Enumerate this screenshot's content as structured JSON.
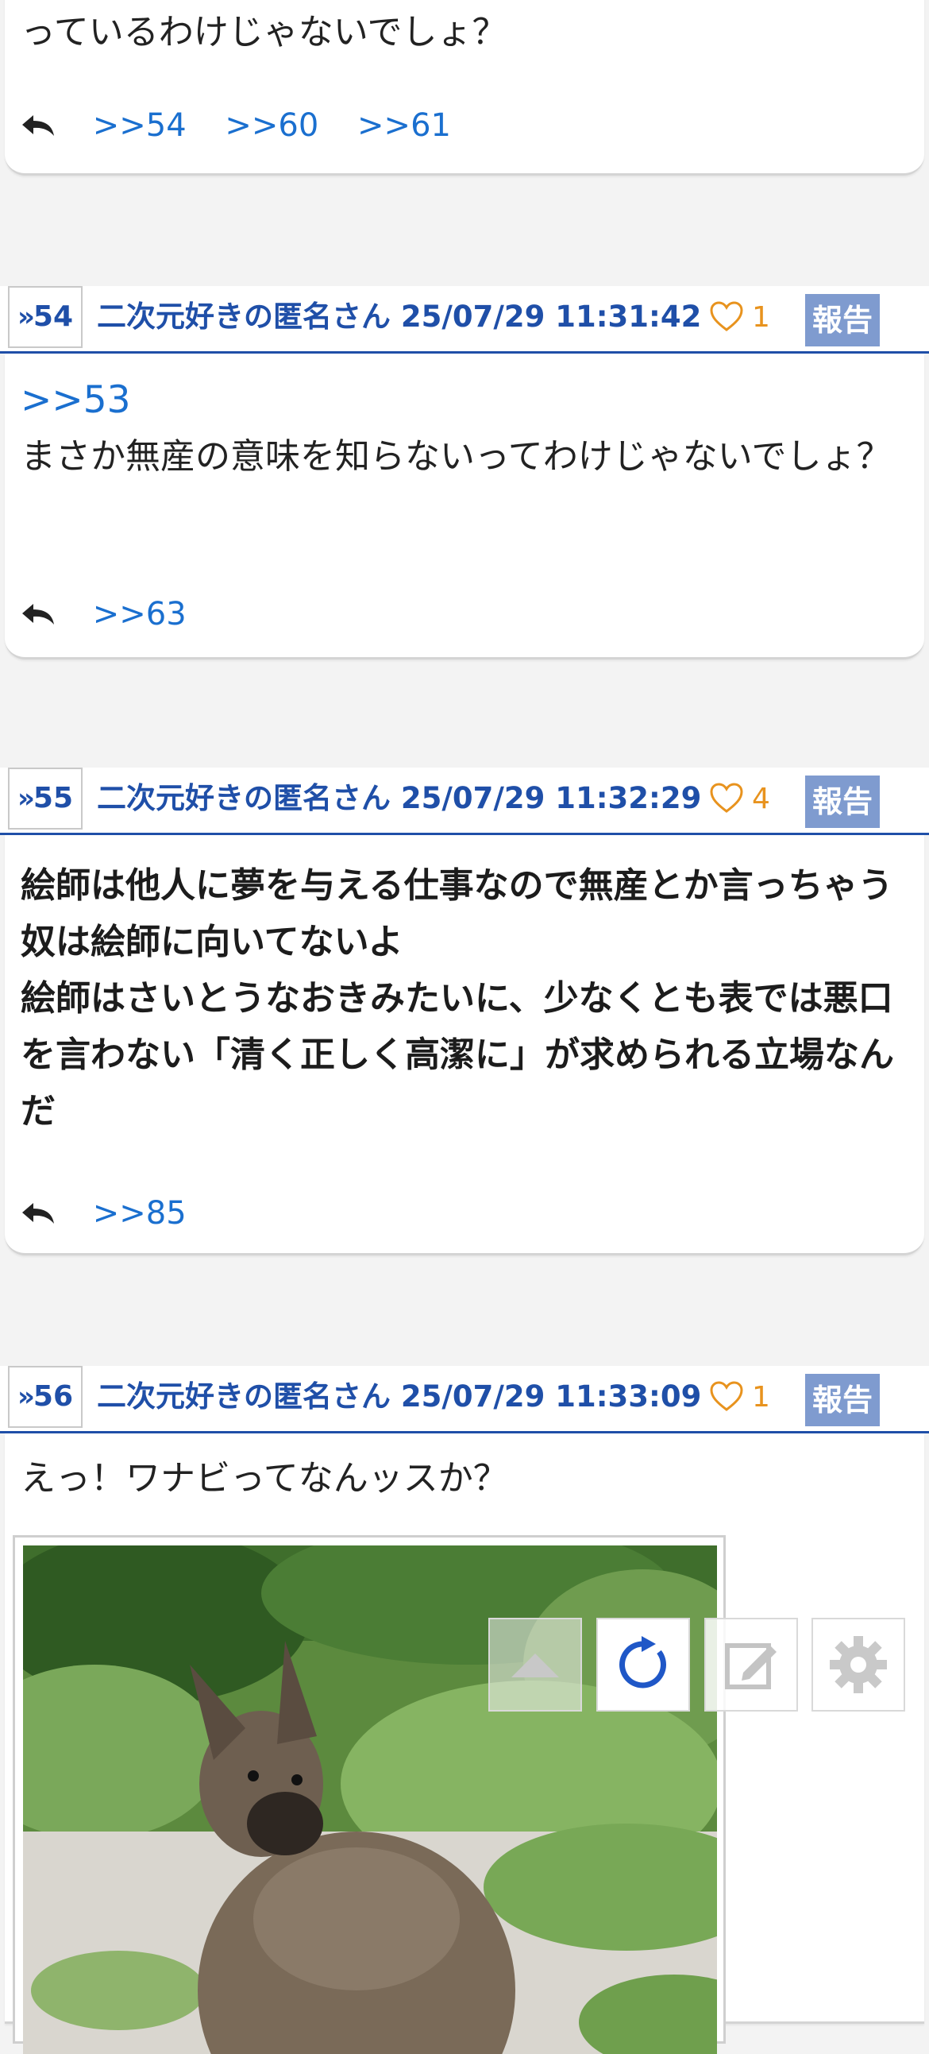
{
  "top_post": {
    "text_tail": "っているわけじゃないでしょ？",
    "replies": [
      ">>54",
      ">>60",
      ">>61"
    ]
  },
  "posts": [
    {
      "number": "54",
      "author": "二次元好きの匿名さん",
      "timestamp": "25/07/29 11:31:42",
      "likes": "1",
      "report_label": "報告",
      "anchor": ">>53",
      "text": "まさか無産の意味を知らないってわけじゃないでしょ？",
      "replies": [
        ">>63"
      ]
    },
    {
      "number": "55",
      "author": "二次元好きの匿名さん",
      "timestamp": "25/07/29 11:32:29",
      "likes": "4",
      "report_label": "報告",
      "text": "絵師は他人に夢を与える仕事なので無産とか言っちゃう奴は絵師に向いてないよ\n絵師はさいとうなおきみたいに、少なくとも表では悪口を言わない「清く正しく高潔に」が求められる立場なんだ",
      "replies": [
        ">>85"
      ]
    },
    {
      "number": "56",
      "author": "二次元好きの匿名さん",
      "timestamp": "25/07/29 11:33:09",
      "likes": "1",
      "report_label": "報告",
      "text": "えっ！ワナビってなんッスか？",
      "image": "wallaby-photo"
    }
  ],
  "floating_toolbar": [
    "scroll-up-icon",
    "refresh-icon",
    "compose-icon",
    "gear-icon"
  ],
  "colors": {
    "accent_blue": "#1f4fa8",
    "link_blue": "#1a6fcf",
    "like_orange": "#e8931e",
    "report_bg": "#7f9bcf"
  }
}
